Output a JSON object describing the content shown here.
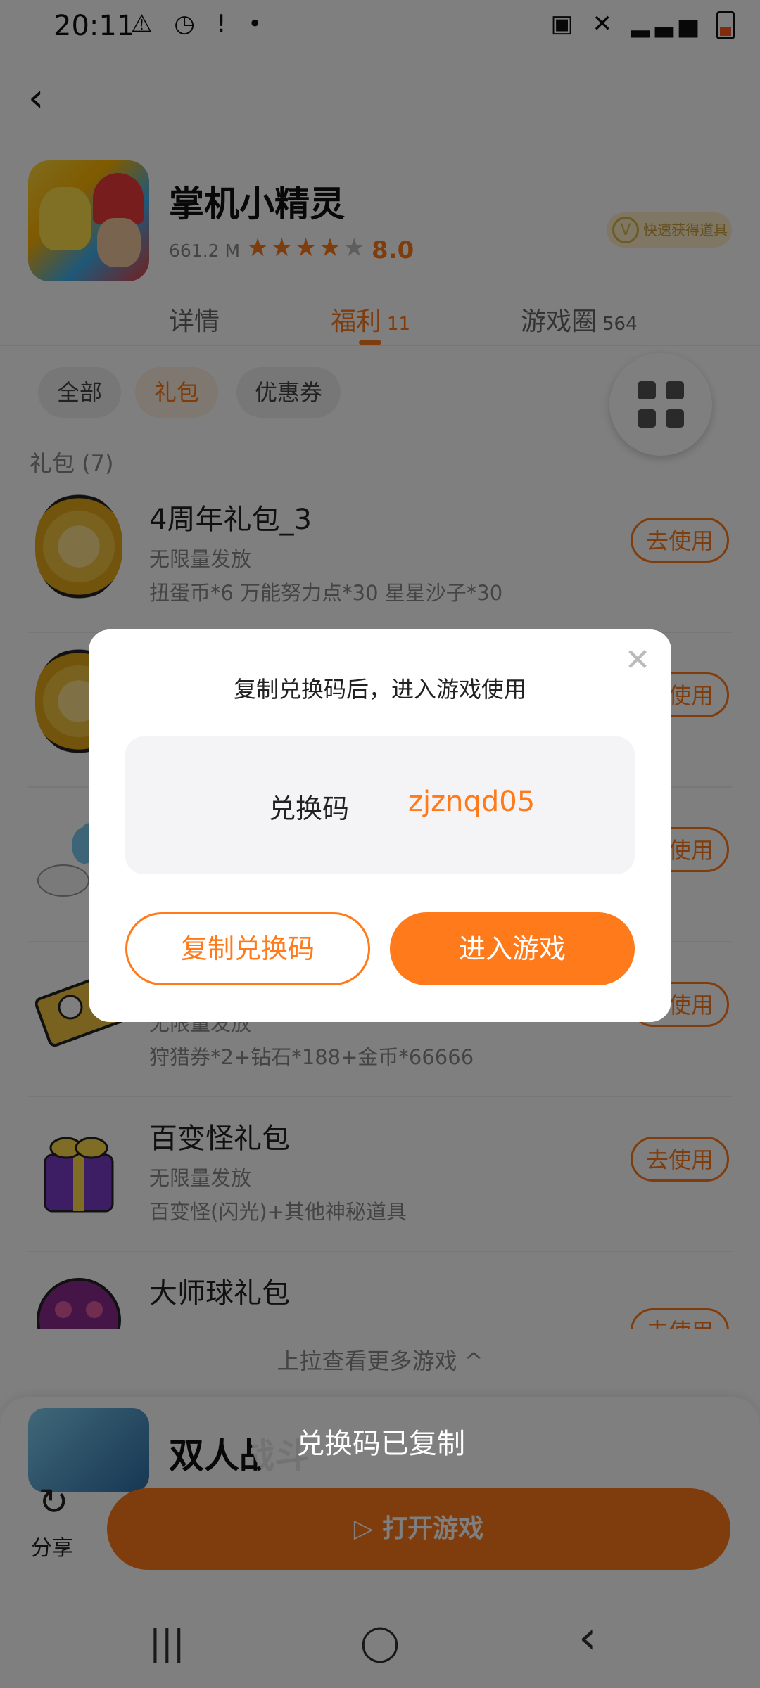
{
  "status_bar": {
    "time": "20:11",
    "left_icons": "⚠ ◷ ! •",
    "right_icons": "▣ ✕ ▂▃▅"
  },
  "app": {
    "title": "掌机小精灵",
    "size": "661.2 M",
    "stars_filled": "★★★★",
    "stars_empty": "★",
    "rating": "8.0",
    "quick_badge": "快速获得道具",
    "quick_badge_icon": "V"
  },
  "tabs": [
    {
      "label": "详情",
      "count": ""
    },
    {
      "label": "福利",
      "count": "11"
    },
    {
      "label": "游戏圈",
      "count": "564"
    }
  ],
  "chips": [
    "全部",
    "礼包",
    "优惠券"
  ],
  "section_title": "礼包 (7)",
  "gifts": [
    {
      "title": "4周年礼包_3",
      "limit": "无限量发放",
      "content": "扭蛋币*6  万能努力点*30  星星沙子*30",
      "action": "去使用"
    },
    {
      "title": "",
      "limit": "",
      "content": "",
      "action": "去使用"
    },
    {
      "title": "",
      "limit": "",
      "content": "",
      "action": "去使用"
    },
    {
      "title": "",
      "limit": "无限量发放",
      "content": "狩猎券*2+钻石*188+金币*66666",
      "action": "去使用"
    },
    {
      "title": "百变怪礼包",
      "limit": "无限量发放",
      "content": "百变怪(闪光)+其他神秘道具",
      "action": "去使用"
    },
    {
      "title": "大师球礼包",
      "limit": "",
      "content": "",
      "action": "去使用"
    }
  ],
  "pull_more": "上拉查看更多游戏 ^",
  "next_game_title": "双人战斗",
  "bottom_bar": {
    "share_label": "分享",
    "open_game_label": "▷ 打开游戏"
  },
  "dialog": {
    "message": "复制兑换码后，进入游戏使用",
    "code_label": "兑换码",
    "code_value": "zjznqd05",
    "copy_button": "复制兑换码",
    "enter_button": "进入游戏",
    "close_icon": "✕"
  },
  "toast": "兑换码已复制",
  "nav": {
    "recents": "|||",
    "home": "◯",
    "back": "‹"
  }
}
